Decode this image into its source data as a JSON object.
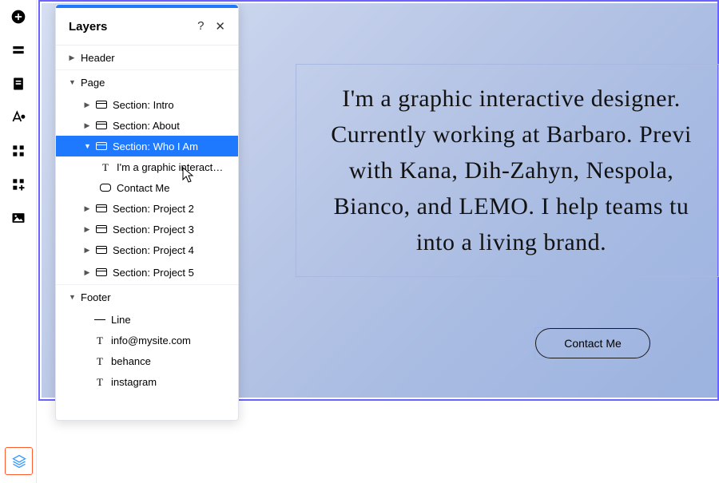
{
  "panel": {
    "title": "Layers",
    "help": "?",
    "close": "✕",
    "sections": {
      "header": "Header",
      "page": "Page",
      "footer": "Footer"
    },
    "page_items": {
      "intro": "Section: Intro",
      "about": "Section: About",
      "whoiam": "Section: Who I Am",
      "whoiam_text": "I'm a graphic interact…",
      "whoiam_btn": "Contact Me",
      "proj2": "Section: Project 2",
      "proj3": "Section: Project 3",
      "proj4": "Section: Project 4",
      "proj5": "Section: Project 5"
    },
    "footer_items": {
      "line": "Line",
      "email": "info@mysite.com",
      "behance": "behance",
      "instagram": "instagram"
    }
  },
  "canvas": {
    "hero_text": "I'm a graphic interactive designer.\nCurrently working at Barbaro. Previ\nwith Kana, Dih-Zahyn, Nespola, \nBianco, and LEMO. I help teams tu\ninto a living brand.",
    "contact": "Contact Me"
  }
}
